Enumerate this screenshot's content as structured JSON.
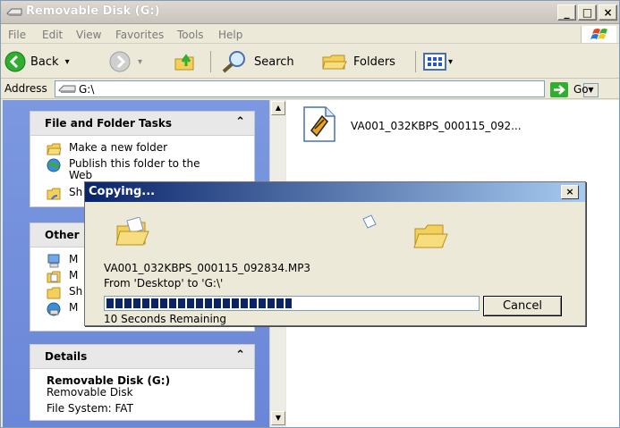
{
  "window": {
    "title": "Removable Disk (G:)",
    "min_glyph": "_",
    "max_glyph": "□",
    "close_glyph": "×"
  },
  "menu": {
    "items": [
      "File",
      "Edit",
      "View",
      "Favorites",
      "Tools",
      "Help"
    ]
  },
  "toolbar": {
    "back_label": "Back",
    "search_label": "Search",
    "folders_label": "Folders",
    "dropdown_glyph": "▾"
  },
  "address": {
    "label": "Address",
    "value": "G:\\",
    "go_label": "Go",
    "dropdown_glyph": "▼"
  },
  "tasks_panel": {
    "title": "File and Folder Tasks",
    "toggle_glyph": "⌃",
    "items": [
      {
        "label": "Make a new folder",
        "icon": "new-folder-icon"
      },
      {
        "label": "Publish this folder to the Web",
        "icon": "publish-web-icon"
      },
      {
        "label": "Sh",
        "icon": "share-folder-icon"
      }
    ]
  },
  "other_panel": {
    "title": "Other",
    "items": [
      {
        "label": "M",
        "icon": "my-computer-icon"
      },
      {
        "label": "M",
        "icon": "my-documents-icon"
      },
      {
        "label": "Sh",
        "icon": "shared-documents-icon"
      },
      {
        "label": "M",
        "icon": "my-network-icon"
      }
    ]
  },
  "details_panel": {
    "title": "Details",
    "toggle_glyph": "⌃",
    "name": "Removable Disk (G:)",
    "type": "Removable Disk",
    "filesystem": "File System: FAT"
  },
  "scrollbar": {
    "up_glyph": "▲",
    "down_glyph": "▼"
  },
  "file": {
    "name": "VA001_032KBPS_000115_092..."
  },
  "dialog": {
    "title": "Copying...",
    "close_glyph": "×",
    "filename": "VA001_032KBPS_000115_092834.MP3",
    "from_to": "From 'Desktop' to 'G:\\'",
    "remaining": "10 Seconds Remaining",
    "cancel_label": "Cancel",
    "progress_fraction": 0.5
  },
  "colors": {
    "dialog_title_start": "#0a246a",
    "dialog_title_end": "#a6caf0",
    "progress_block": "#0a246a",
    "task_pane_bg": "#7b98e0",
    "go_arrow": "#2fae2f"
  }
}
